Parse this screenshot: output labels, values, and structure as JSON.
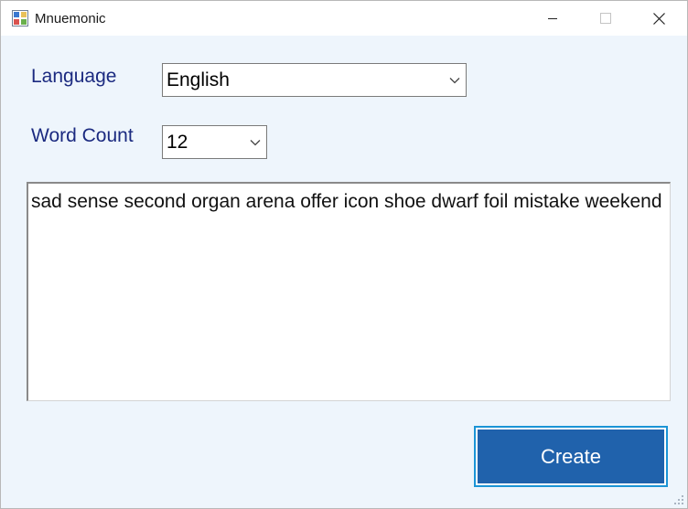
{
  "window": {
    "title": "Mnuemonic"
  },
  "form": {
    "language_label": "Language",
    "language_value": "English",
    "word_count_label": "Word Count",
    "word_count_value": "12",
    "mnemonic_text": "sad sense second organ arena offer icon shoe dwarf foil mistake weekend",
    "create_label": "Create"
  },
  "icons": {
    "app": "app-window-icon",
    "minimize": "minimize-icon",
    "maximize": "maximize-icon",
    "close": "close-icon",
    "dropdown": "chevron-down-icon",
    "resize": "resize-grip-icon"
  },
  "colors": {
    "form_background": "#eef5fc",
    "label_text": "#1b2a80",
    "button_fill": "#2062ac",
    "button_border": "#1b94d6"
  }
}
